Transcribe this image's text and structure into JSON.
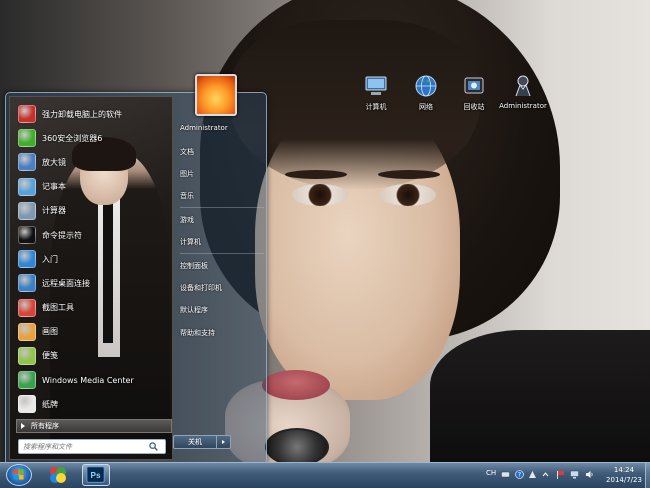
{
  "desktop": {
    "icons": [
      {
        "label": "计算机",
        "icon": "computer-icon"
      },
      {
        "label": "网络",
        "icon": "network-globe-icon"
      },
      {
        "label": "回收站",
        "icon": "recycle-bin-icon"
      },
      {
        "label": "Administrator",
        "icon": "user-folder-icon"
      }
    ]
  },
  "start_menu": {
    "programs": [
      {
        "label": "强力卸载电脑上的软件",
        "icon": "uninstall-icon",
        "color": "#c9302c"
      },
      {
        "label": "360安全浏览器6",
        "icon": "browser-360-icon",
        "color": "#3fae2a"
      },
      {
        "label": "放大镜",
        "icon": "magnifier-icon",
        "color": "#4a7fc1"
      },
      {
        "label": "记事本",
        "icon": "notepad-icon",
        "color": "#5aa0d8"
      },
      {
        "label": "计算器",
        "icon": "calculator-icon",
        "color": "#7f98b2"
      },
      {
        "label": "命令提示符",
        "icon": "cmd-icon",
        "color": "#111111"
      },
      {
        "label": "入门",
        "icon": "getting-started-icon",
        "color": "#2f86d6"
      },
      {
        "label": "远程桌面连接",
        "icon": "remote-desktop-icon",
        "color": "#3b7fc4"
      },
      {
        "label": "截图工具",
        "icon": "snipping-tool-icon",
        "color": "#d9433a"
      },
      {
        "label": "画图",
        "icon": "paint-icon",
        "color": "#e9a23b"
      },
      {
        "label": "便笺",
        "icon": "sticky-notes-icon",
        "color": "#8fc44a"
      },
      {
        "label": "Windows Media Center",
        "icon": "media-center-icon",
        "color": "#3aa24b"
      },
      {
        "label": "纸牌",
        "icon": "solitaire-icon",
        "color": "#e8e8e8"
      }
    ],
    "all_programs_label": "所有程序",
    "search_placeholder": "搜索程序和文件",
    "user_links": [
      "Administrator",
      "文档",
      "图片",
      "音乐",
      "游戏",
      "计算机",
      "控制面板",
      "设备和打印机",
      "默认程序",
      "帮助和支持"
    ],
    "shutdown_label": "关机"
  },
  "taskbar": {
    "apps": [
      {
        "name": "360-app",
        "icon": "app-360-icon"
      },
      {
        "name": "photoshop",
        "icon": "photoshop-icon",
        "text": "Ps"
      }
    ],
    "tray": {
      "lang": "CH",
      "icons": [
        "keyboard-icon",
        "help-icon",
        "input-method-icon",
        "arrow-icon",
        "flag-icon",
        "network-tray-icon",
        "volume-icon"
      ]
    },
    "clock": {
      "time": "14:24",
      "date": "2014/7/23"
    }
  }
}
